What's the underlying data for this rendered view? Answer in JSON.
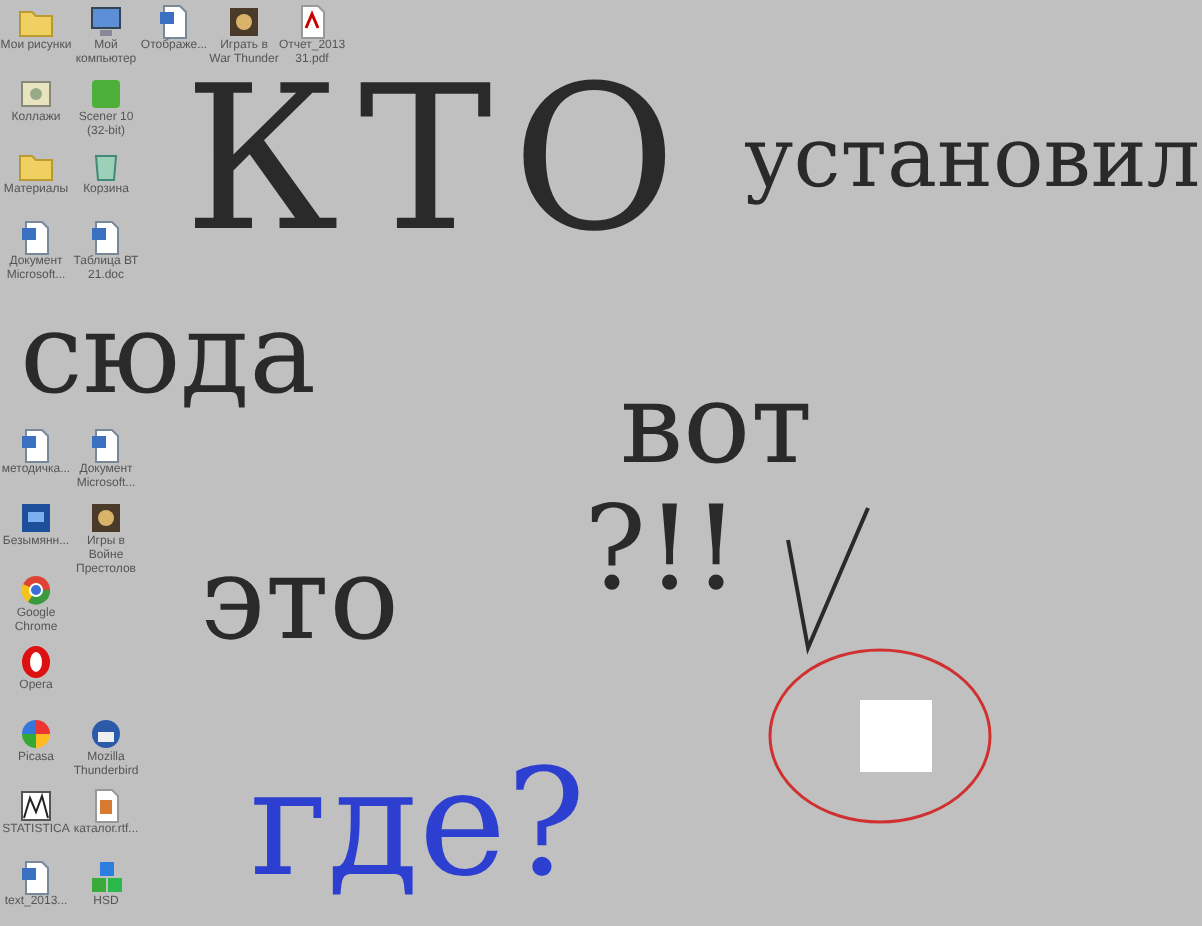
{
  "desktop_icons": [
    {
      "label": "Мои рисунки",
      "kind": "folder"
    },
    {
      "label": "Мой компьютер",
      "kind": "computer"
    },
    {
      "label": "Отображе...",
      "kind": "doc"
    },
    {
      "label": "Играть в War Thunder",
      "kind": "game"
    },
    {
      "label": "Отчет_2013 31.pdf",
      "kind": "pdf"
    },
    {
      "label": "Коллажи",
      "kind": "photo"
    },
    {
      "label": "Scener 10 (32-bit)",
      "kind": "app"
    },
    {
      "label": "Материалы",
      "kind": "folder"
    },
    {
      "label": "Корзина",
      "kind": "bin"
    },
    {
      "label": "Документ Microsoft...",
      "kind": "doc"
    },
    {
      "label": "Таблица ВТ 21.doc",
      "kind": "doc"
    },
    {
      "label": "методичка...",
      "kind": "doc"
    },
    {
      "label": "Документ Microsoft...",
      "kind": "doc"
    },
    {
      "label": "Безымянн...",
      "kind": "ps"
    },
    {
      "label": "Игры в Войне Престолов",
      "kind": "game"
    },
    {
      "label": "Google Chrome",
      "kind": "chrome"
    },
    {
      "label": "Opera",
      "kind": "opera"
    },
    {
      "label": "Picasa",
      "kind": "picasa"
    },
    {
      "label": "Mozilla Thunderbird",
      "kind": "thunderbird"
    },
    {
      "label": "STATISTICA",
      "kind": "chart"
    },
    {
      "label": "каталог.rtf...",
      "kind": "archive"
    },
    {
      "label": "text_2013...",
      "kind": "doc"
    },
    {
      "label": "HSD",
      "kind": "cubes"
    }
  ],
  "scribbles": [
    {
      "text": "КТО",
      "color": "#2a2a2a"
    },
    {
      "text": "установил",
      "color": "#2a2a2a"
    },
    {
      "text": "сюда",
      "color": "#2a2a2a"
    },
    {
      "text": "вот",
      "color": "#2a2a2a"
    },
    {
      "text": "это",
      "color": "#2a2a2a"
    },
    {
      "text": "?!!",
      "color": "#2a2a2a"
    },
    {
      "text": "где?",
      "color": "#2d3fd0"
    }
  ]
}
